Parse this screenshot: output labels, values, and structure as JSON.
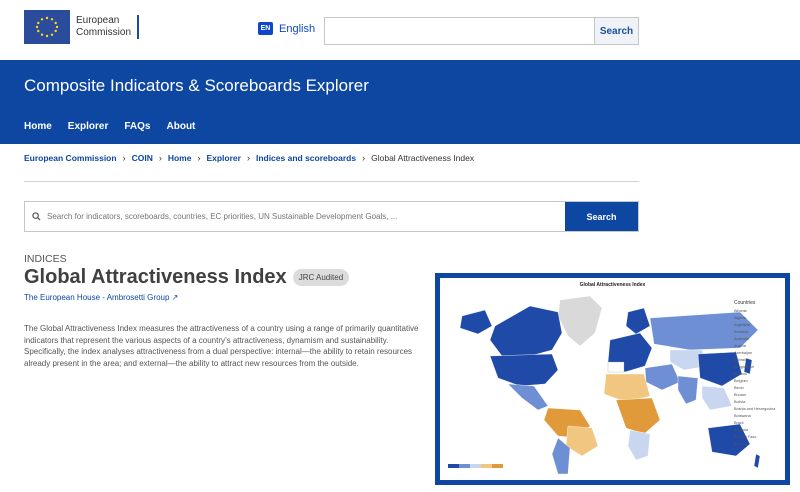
{
  "header": {
    "logo_line1": "European",
    "logo_line2": "Commission",
    "lang_code": "EN",
    "language": "English",
    "search_button": "Search"
  },
  "banner": {
    "title": "Composite Indicators & Scoreboards Explorer",
    "nav": [
      "Home",
      "Explorer",
      "FAQs",
      "About"
    ]
  },
  "breadcrumb": [
    "European Commission",
    "COIN",
    "Home",
    "Explorer",
    "Indices and scoreboards",
    "Global Attractiveness Index"
  ],
  "search": {
    "placeholder": "Search for indicators, scoreboards, countries, EC priorities, UN Sustainable Development Goals, ...",
    "button": "Search"
  },
  "index": {
    "eyebrow": "INDICES",
    "title": "Global Attractiveness Index",
    "badge": "JRC Audited",
    "organization": "The European House - Ambrosetti Group",
    "description": "The Global Attractiveness Index measures the attractiveness of a country using a range of primarily quantitative indicators that represent the various aspects of a country’s attractiveness, dynamism and sustainability. Specifically, the index analyses attractiveness from a dual perspective: internal—the ability to retain resources already present in the area; and external—the ability to attract new resources from the outside."
  },
  "map": {
    "title": "Global Attractiveness Index",
    "legend_title": "Countries",
    "countries": [
      "Albania",
      "Algeria",
      "Argentina",
      "Armenia",
      "Australia",
      "Austria",
      "Azerbaijan",
      "Bahrain",
      "Bangladesh",
      "Belarus",
      "Belgium",
      "Benin",
      "Bhutan",
      "Bolivia",
      "Bosnia and Herzegovina",
      "Botswana",
      "Brazil",
      "Bulgaria",
      "Burkina Faso",
      "Burundi"
    ],
    "colors": {
      "high": "#1f4aa8",
      "mid": "#6f8fd4",
      "low": "#c9d6ef",
      "lower": "#f0c680",
      "lowest": "#e09a3a",
      "nodata": "#d9d9d9"
    }
  }
}
